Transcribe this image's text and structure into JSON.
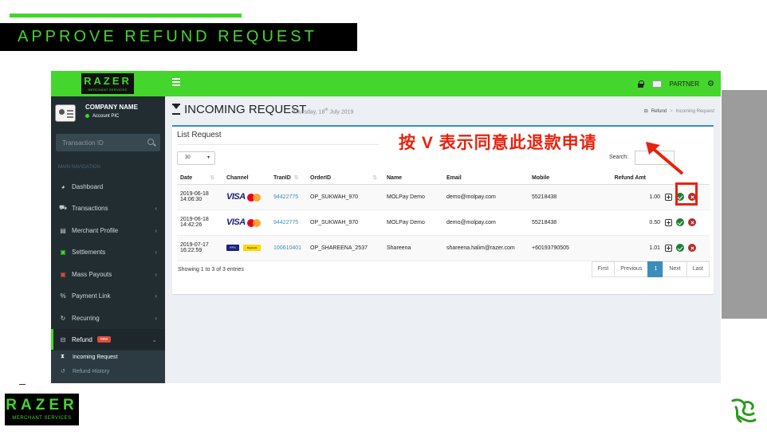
{
  "slide": {
    "title": "APPROVE REFUND REQUEST",
    "annotation": "按 V 表示同意此退款申请",
    "footer_logo_line1": "RAZER",
    "footer_logo_line2": "MERCHANT SERVICES"
  },
  "topbar": {
    "logo_line1": "RAZER",
    "logo_line2": "MERCHANT SERVICES",
    "partner_label": "PARTNER",
    "icons": [
      "menu-icon",
      "lock-icon",
      "user-icon",
      "gear-icon"
    ]
  },
  "sidebar": {
    "company_name": "COMPANY NAME",
    "account_label": "Account PIC",
    "search_placeholder": "Transaction ID",
    "nav_header": "MAIN NAVIGATION",
    "items": [
      {
        "label": "Dashboard",
        "icon": "dashboard-icon"
      },
      {
        "label": "Transactions",
        "icon": "cart-icon"
      },
      {
        "label": "Merchant Profile",
        "icon": "profile-icon"
      },
      {
        "label": "Settlements",
        "icon": "money-icon"
      },
      {
        "label": "Mass Payouts",
        "icon": "payout-icon"
      },
      {
        "label": "Payment Link",
        "icon": "link-icon"
      },
      {
        "label": "Recurring",
        "icon": "recurring-icon"
      },
      {
        "label": "Refund",
        "icon": "refund-icon",
        "badge": "new"
      }
    ],
    "submenu": [
      {
        "label": "Incoming Request",
        "icon": "hourglass-icon"
      },
      {
        "label": "Refund History",
        "icon": "history-icon"
      }
    ]
  },
  "header": {
    "title": "INCOMING REQUEST",
    "date_prefix": "Thursday, 18",
    "date_sup": "th",
    "date_suffix": " July 2019",
    "breadcrumb": [
      "Refund",
      ">",
      "Incoming Request"
    ]
  },
  "box": {
    "title": "List Request",
    "page_length": "30",
    "search_label": "Search:",
    "columns": [
      "Date",
      "Channel",
      "TranID",
      "OrderID",
      "Name",
      "Email",
      "Mobile",
      "Refund Amt",
      ""
    ],
    "rows": [
      {
        "date": "2019-06-18",
        "time": "14:06:30",
        "channel": "VISA",
        "tranid": "94422775",
        "orderid": "OP_SUKWAH_970",
        "name": "MOLPay Demo",
        "email": "demo@molpay.com",
        "mobile": "55218438",
        "amount": "1.00"
      },
      {
        "date": "2019-06-18",
        "time": "14:42:26",
        "channel": "VISA",
        "tranid": "94422775",
        "orderid": "OP_SUKWAH_970",
        "name": "MOLPay Demo",
        "email": "demo@molpay.com",
        "mobile": "55218438",
        "amount": "0.50"
      },
      {
        "date": "2019-07-17",
        "time": "16:22:59",
        "channel": "FPX",
        "tranid": "100610401",
        "orderid": "OP_SHAREENA_2537",
        "name": "Shareena",
        "email": "shareena.halim@razer.com",
        "mobile": "+60193790505",
        "amount": "1.01"
      }
    ],
    "fpx_label": "FPX",
    "bank_label": "Maybank",
    "showing": "Showing 1 to 3 of 3 entries",
    "pager": [
      "First",
      "Previous",
      "1",
      "Next",
      "Last"
    ]
  },
  "colors": {
    "razer_green": "#44d62c",
    "sidebar_bg": "#222d32",
    "annotation_red": "#e8220c",
    "approve_green": "#1e7e34",
    "reject_red": "#b52b27"
  }
}
